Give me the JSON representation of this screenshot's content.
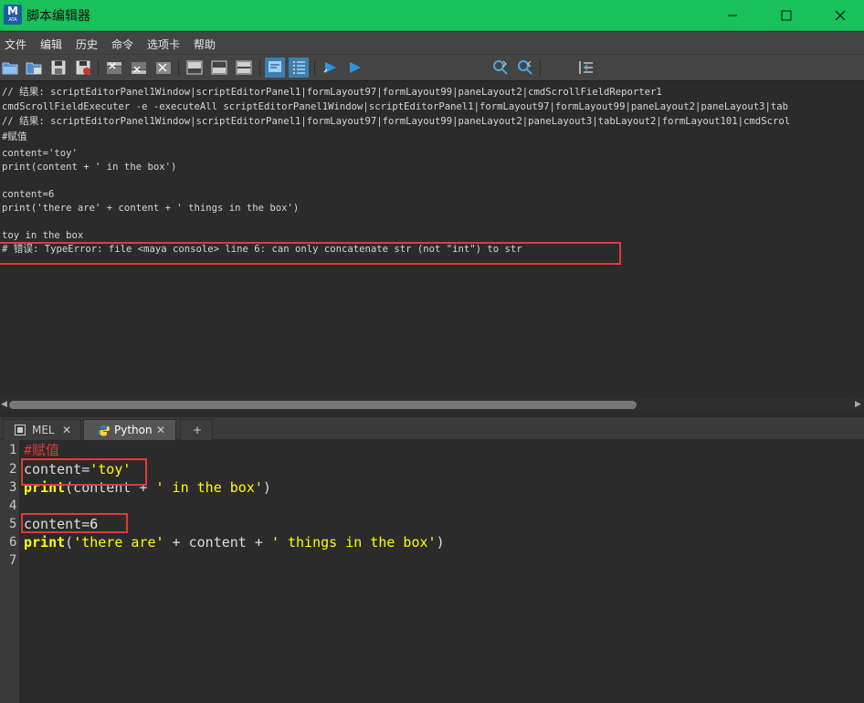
{
  "window": {
    "title": "脚本编辑器",
    "app_icon_letter": "M",
    "app_icon_sub": "ATA",
    "controls": [
      "minimize-icon",
      "maximize-icon",
      "close-icon"
    ]
  },
  "menu": {
    "items": [
      "文件",
      "编辑",
      "历史",
      "命令",
      "选项卡",
      "帮助"
    ]
  },
  "toolbar": {
    "icons": [
      "open-script-icon",
      "source-script-icon",
      "save-script-icon",
      "save-script-to-shelf-icon",
      "clear-history-icon",
      "clear-input-icon",
      "clear-all-icon",
      "show-history-only-icon",
      "show-input-only-icon",
      "show-both-icon",
      "echo-all-commands-icon",
      "show-line-numbers-icon",
      "execute-all-icon",
      "execute-selected-icon",
      "search-next-icon",
      "search-previous-icon",
      "go-to-line-icon"
    ],
    "search_value": "",
    "line_value": ""
  },
  "output": {
    "lines": [
      "// 结果: scriptEditorPanel1Window|scriptEditorPanel1|formLayout97|formLayout99|paneLayout2|cmdScrollFieldReporter1",
      "cmdScrollFieldExecuter -e -executeAll scriptEditorPanel1Window|scriptEditorPanel1|formLayout97|formLayout99|paneLayout2|paneLayout3|tab",
      "// 结果: scriptEditorPanel1Window|scriptEditorPanel1|formLayout97|formLayout99|paneLayout2|paneLayout3|tabLayout2|formLayout101|cmdScrol",
      "#赋值",
      "content='toy'",
      "print(content + ' in the box')",
      "",
      "content=6",
      "print('there are' + content + ' things in the box')",
      "",
      "toy in the box",
      "# 错误: TypeError: file <maya console> line 6: can only concatenate str (not \"int\") to str"
    ]
  },
  "tabs": [
    {
      "label": "MEL",
      "icon": "mel-tab-icon",
      "close": "✕",
      "active": false
    },
    {
      "label": "Python",
      "icon": "python-tab-icon",
      "close": "✕",
      "active": true
    },
    {
      "label": "+",
      "active": false
    }
  ],
  "editor": {
    "line_numbers": [
      "1",
      "2",
      "3",
      "4",
      "5",
      "6",
      "7"
    ],
    "lines": [
      [
        {
          "t": "#赋值",
          "c": "comment"
        }
      ],
      [
        {
          "t": "content=",
          "c": "plain"
        },
        {
          "t": "'toy'",
          "c": "str"
        }
      ],
      [
        {
          "t": "print",
          "c": "kw"
        },
        {
          "t": "(content + ",
          "c": "plain"
        },
        {
          "t": "' in the box'",
          "c": "str"
        },
        {
          "t": ")",
          "c": "plain"
        }
      ],
      [],
      [
        {
          "t": "content=",
          "c": "plain"
        },
        {
          "t": "6",
          "c": "num"
        }
      ],
      [
        {
          "t": "print",
          "c": "kw"
        },
        {
          "t": "(",
          "c": "plain"
        },
        {
          "t": "'there are'",
          "c": "str"
        },
        {
          "t": " + content + ",
          "c": "plain"
        },
        {
          "t": "' things in the box'",
          "c": "str"
        },
        {
          "t": ")",
          "c": "plain"
        }
      ],
      []
    ]
  },
  "colors": {
    "title_bar": "#18c15a",
    "panel_bg": "#2b2b2b",
    "error_highlight": "#e23a3a",
    "string_color": "#ffff00",
    "comment_color": "#d83a3a"
  }
}
